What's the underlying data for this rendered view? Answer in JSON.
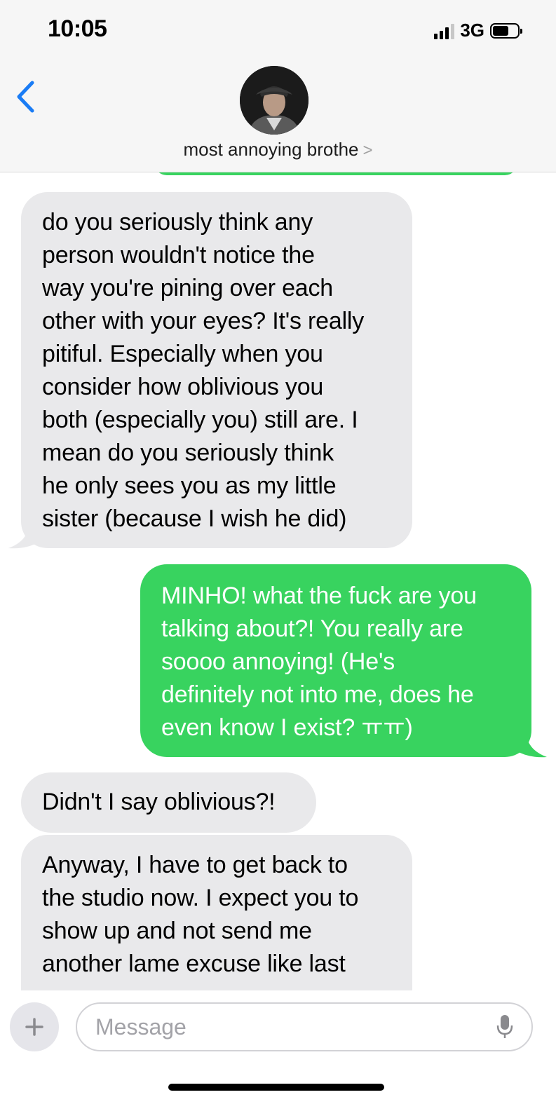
{
  "status_bar": {
    "time": "10:05",
    "network": "3G"
  },
  "header": {
    "contact_name": "most annoying brothe",
    "chevron": ">"
  },
  "messages": [
    {
      "direction": "received",
      "text": "do you seriously think any\nperson wouldn't notice the\nway you're pining over each\nother with your eyes? It's really\npitiful. Especially when you\nconsider how oblivious you\nboth (especially you) still are. I\nmean do you seriously think\nhe only sees you as my little\nsister (because I wish he did)"
    },
    {
      "direction": "sent",
      "text": "MINHO! what the fuck are you\ntalking about?! You really are\nsoooo annoying! (He's\ndefinitely not into me, does he\neven know I exist? ㅠㅠ)"
    },
    {
      "direction": "received",
      "text": "Didn't I say oblivious?!"
    },
    {
      "direction": "received",
      "text": "Anyway, I have to get back to\nthe studio now. I expect you to\nshow up and not send me\nanother lame excuse like last"
    }
  ],
  "input": {
    "placeholder": "Message",
    "value": ""
  },
  "colors": {
    "sent_bubble": "#38d35f",
    "received_bubble": "#e9e9eb",
    "accent_blue": "#1a7cf5"
  },
  "icons": {
    "back": "chevron-left-icon",
    "add": "plus-icon",
    "mic": "microphone-icon"
  }
}
